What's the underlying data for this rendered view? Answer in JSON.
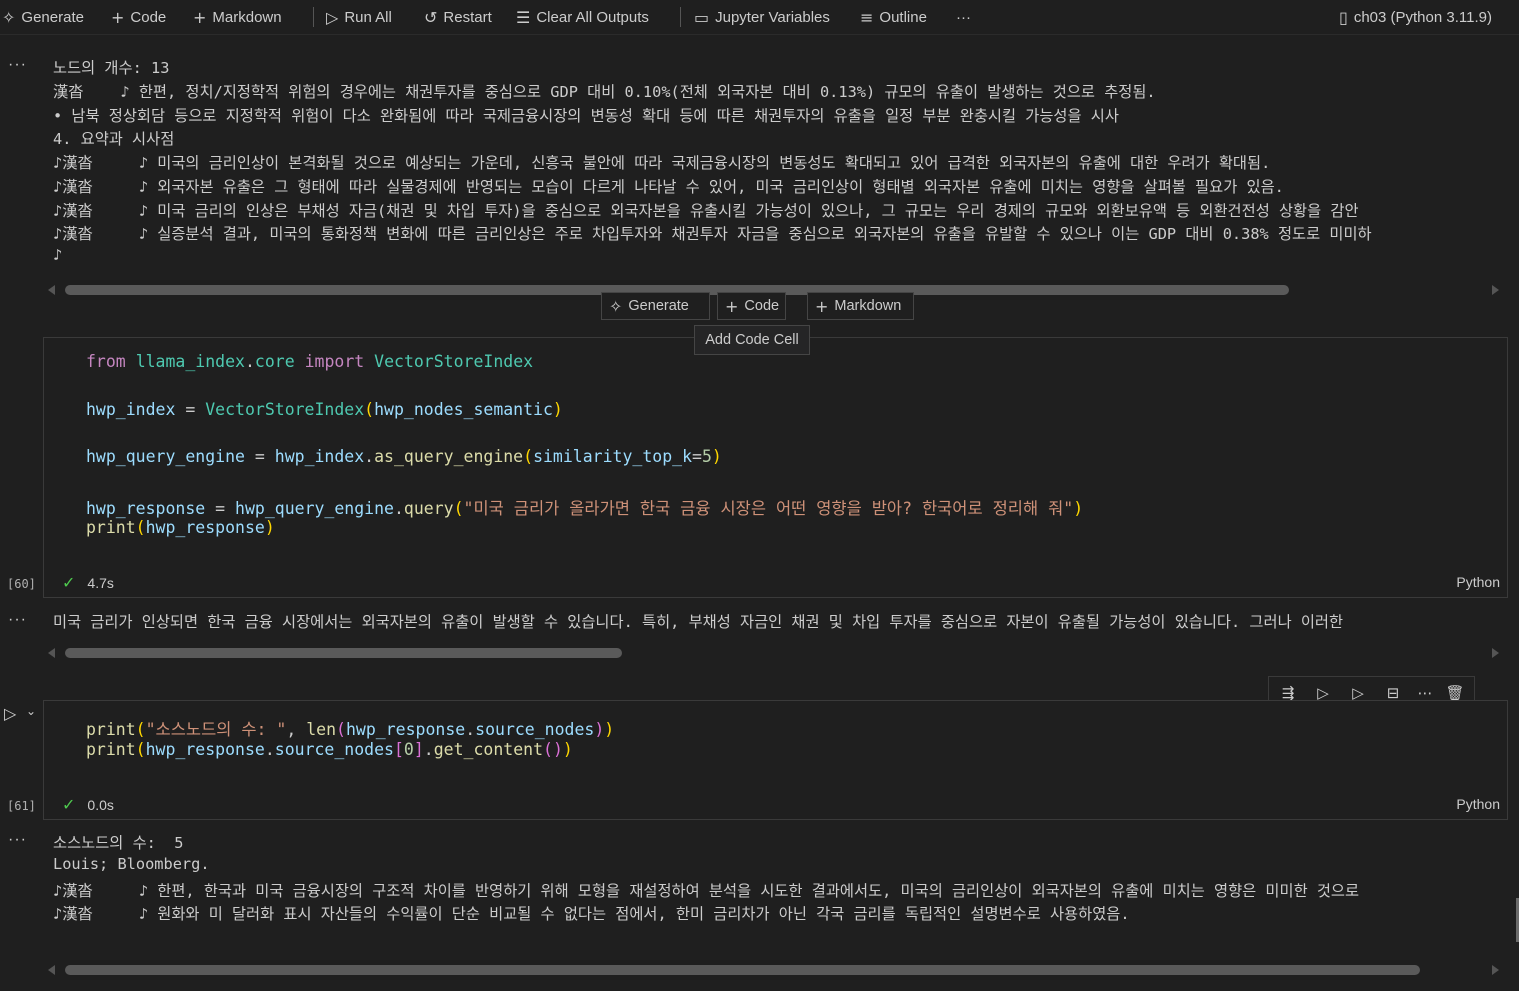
{
  "toolbar": {
    "generate": "Generate",
    "code": "Code",
    "markdown": "Markdown",
    "run_all": "Run All",
    "restart": "Restart",
    "clear_all_outputs": "Clear All Outputs",
    "jupyter_variables": "Jupyter Variables",
    "outline": "Outline",
    "more": "···",
    "kernel": "ch03 (Python 3.11.9)"
  },
  "output1": {
    "lines": [
      "노드의 개수: 13",
      "漢沓    ♪ 한편, 정치/지정학적 위험의 경우에는 채권투자를 중심으로 GDP 대비 0.10%(전체 외국자본 대비 0.13%) 규모의 유출이 발생하는 것으로 추정됨.",
      "• 남북 정상회담 등으로 지정학적 위험이 다소 완화됨에 따라 국제금융시장의 변동성 확대 등에 따른 채권투자의 유출을 일정 부분 완충시킬 가능성을 시사",
      "4. 요약과 시사점",
      "♪漢沓     ♪ 미국의 금리인상이 본격화될 것으로 예상되는 가운데, 신흥국 불안에 따라 국제금융시장의 변동성도 확대되고 있어 급격한 외국자본의 유출에 대한 우려가 확대됨.",
      "♪漢沓     ♪ 외국자본 유출은 그 형태에 따라 실물경제에 반영되는 모습이 다르게 나타날 수 있어, 미국 금리인상이 형태별 외국자본 유출에 미치는 영향을 살펴볼 필요가 있음.",
      "♪漢沓     ♪ 미국 금리의 인상은 부채성 자금(채권 및 차입 투자)을 중심으로 외국자본을 유출시킬 가능성이 있으나, 그 규모는 우리 경제의 규모와 외환보유액 등 외환건전성 상황을 감안",
      "♪漢沓     ♪ 실증분석 결과, 미국의 통화정책 변화에 따른 금리인상은 주로 차입투자와 채권투자 자금을 중심으로 외국자본의 유출을 유발할 수 있으나 이는 GDP 대비 0.38% 정도로 미미하",
      "♪"
    ]
  },
  "insert_bar": {
    "generate": "Generate",
    "code": "Code",
    "markdown": "Markdown",
    "tooltip": "Add Code Cell"
  },
  "cell60": {
    "exec_count": "[60]",
    "time": "4.7s",
    "lang": "Python"
  },
  "output2": {
    "line": "미국 금리가 인상되면 한국 금융 시장에서는 외국자본의 유출이 발생할 수 있습니다. 특히, 부채성 자금인 채권 및 차입 투자를 중심으로 자본이 유출될 가능성이 있습니다. 그러나 이러한"
  },
  "cell61": {
    "exec_count": "[61]",
    "time": "0.0s",
    "lang": "Python"
  },
  "output3": {
    "lines": [
      "소스노드의 수:  5",
      "Louis; Bloomberg.",
      "♪漢沓     ♪ 한편, 한국과 미국 금융시장의 구조적 차이를 반영하기 위해 모형을 재설정하여 분석을 시도한 결과에서도, 미국의 금리인상이 외국자본의 유출에 미치는 영향은 미미한 것으로",
      "♪漢沓     ♪ 원화와 미 달러화 표시 자산들의 수익률이 단순 비교될 수 없다는 점에서, 한미 금리차가 아닌 각국 금리를 독립적인 설명변수로 사용하였음."
    ]
  },
  "code60": {
    "l1": [
      "from",
      "llama_index",
      ".",
      "core",
      "import",
      "VectorStoreIndex"
    ],
    "l2": [
      "hwp_index",
      "=",
      "VectorStoreIndex",
      "(",
      "hwp_nodes_semantic",
      ")"
    ],
    "l3": [
      "hwp_query_engine",
      "=",
      "hwp_index",
      ".",
      "as_query_engine",
      "(",
      "similarity_top_k",
      "=",
      "5",
      ")"
    ],
    "l4": [
      "hwp_response",
      "=",
      "hwp_query_engine",
      ".",
      "query",
      "(",
      "\"미국 금리가 올라가면 한국 금융 시장은 어떤 영향을 받아? 한국어로 정리해 줘\"",
      ")"
    ],
    "l5": [
      "print",
      "(",
      "hwp_response",
      ")"
    ]
  },
  "code61": {
    "l1": [
      "print",
      "(",
      "\"소스노드의 수: \"",
      ", ",
      "len",
      "(",
      "hwp_response",
      ".",
      "source_nodes",
      ")",
      ")"
    ],
    "l2": [
      "print",
      "(",
      "hwp_response",
      ".",
      "source_nodes",
      "[",
      "0",
      "]",
      ".",
      "get_content",
      "(",
      ")",
      ")"
    ]
  },
  "icons": [
    "sparkle-icon",
    "plus-icon",
    "run-all-icon",
    "restart-icon",
    "clear-outputs-icon",
    "variables-icon",
    "outline-icon",
    "kernel-icon",
    "check-icon",
    "run-cell-icon",
    "chevron-down-icon",
    "run-by-line-icon",
    "execute-above-icon",
    "execute-below-icon",
    "split-cell-icon",
    "more-icon",
    "delete-icon"
  ]
}
